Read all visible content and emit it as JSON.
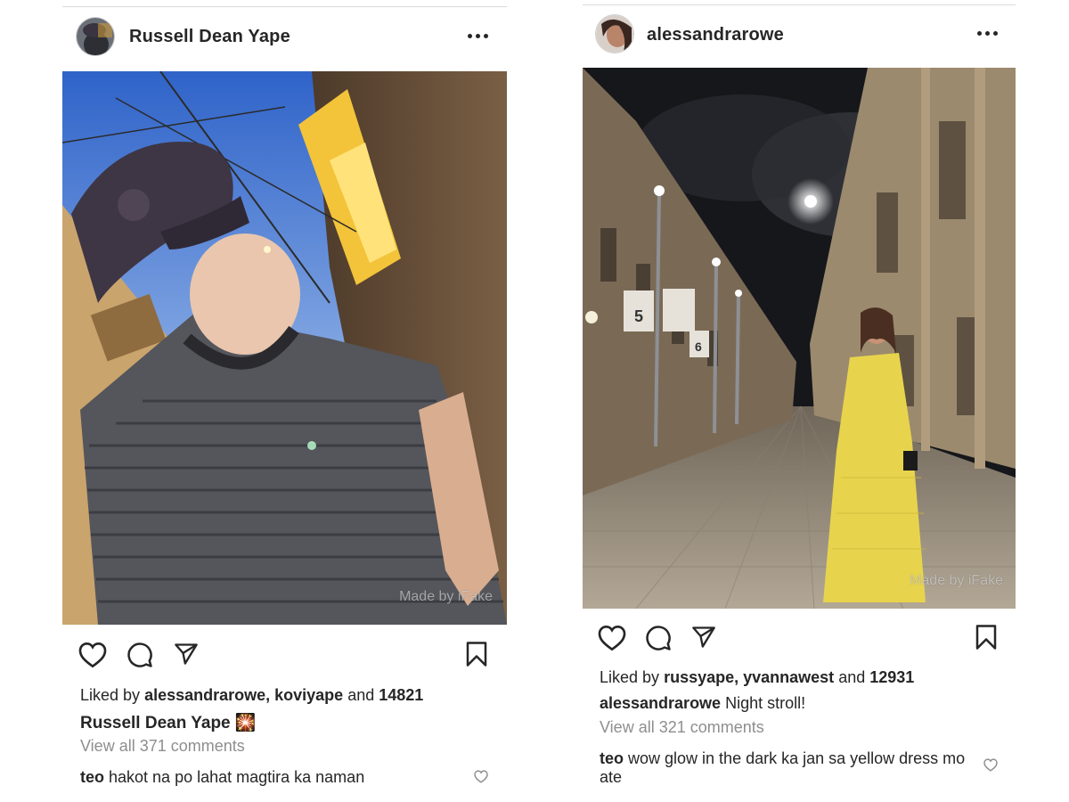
{
  "posts": [
    {
      "username": "Russell Dean Yape",
      "liked_by_prefix": "Liked by",
      "liked_by_users": "alessandrarowe, koviyape",
      "liked_by_and": "and",
      "likes_count": "14821",
      "caption_user": "Russell Dean Yape",
      "caption_text": "🎇",
      "view_comments": "View all 371 comments",
      "comment_user": "teo",
      "comment_text": "hakot na po lahat magtira ka naman",
      "watermark": "Made by iFake"
    },
    {
      "username": "alessandrarowe",
      "liked_by_prefix": "Liked by",
      "liked_by_users": "russyape, yvannawest",
      "liked_by_and": "and",
      "likes_count": "12931",
      "caption_user": "alessandrarowe",
      "caption_text": "Night stroll!",
      "view_comments": "View all 321 comments",
      "comment_user": "teo",
      "comment_text_line1": "wow glow in the dark ka jan sa yellow dress mo",
      "comment_text_line2": "ate",
      "watermark": "Made by iFake",
      "signs": [
        "5",
        "6"
      ]
    }
  ],
  "icons": {
    "like": "heart-icon",
    "comment": "comment-bubble-icon",
    "share": "paper-plane-icon",
    "save": "bookmark-icon",
    "more": "more-options-icon",
    "comment_like": "small-heart-icon"
  },
  "colors": {
    "text": "#262626",
    "muted": "#8e8e8e",
    "divider": "#dbdbdb"
  }
}
